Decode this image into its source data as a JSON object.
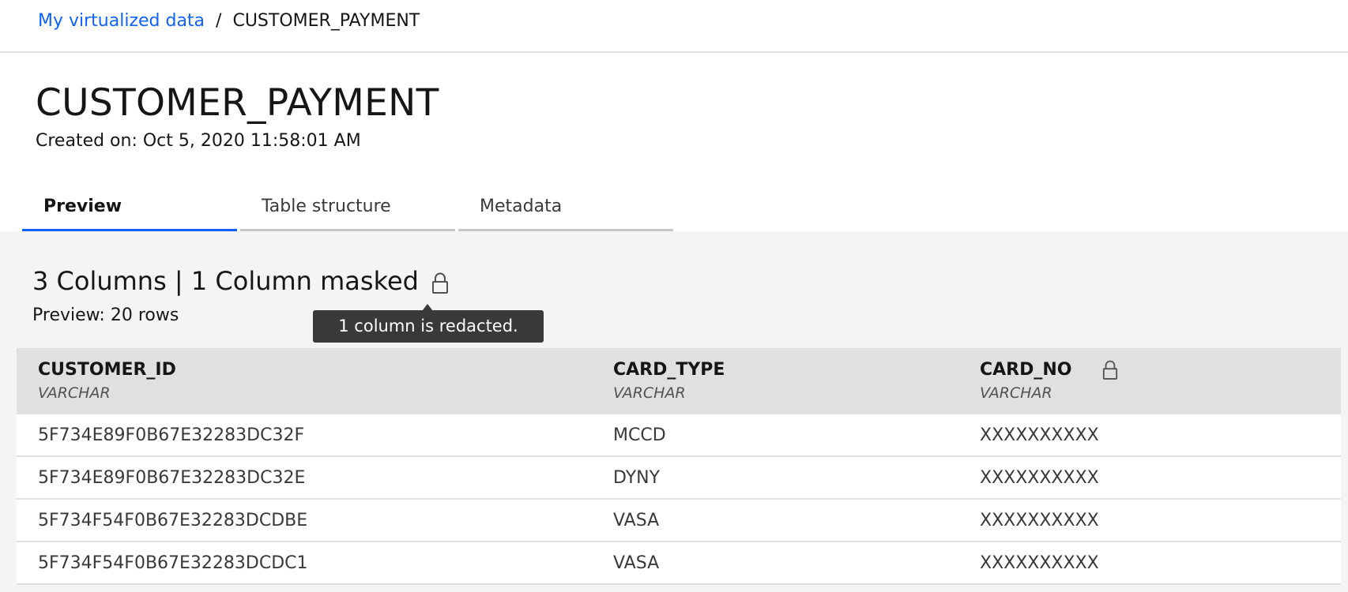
{
  "breadcrumb": {
    "link_label": "My virtualized data",
    "separator": "/",
    "current": "CUSTOMER_PAYMENT"
  },
  "page": {
    "title": "CUSTOMER_PAYMENT",
    "created": "Created on: Oct 5, 2020 11:58:01 AM"
  },
  "tabs": [
    {
      "label": "Preview",
      "active": true
    },
    {
      "label": "Table structure",
      "active": false
    },
    {
      "label": "Metadata",
      "active": false
    }
  ],
  "summary": {
    "text": "3 Columns | 1 Column masked",
    "preview_rows": "Preview: 20 rows",
    "lock_icon": "lock-icon"
  },
  "tooltip": {
    "text": "1 column is redacted."
  },
  "table": {
    "columns": [
      {
        "name": "CUSTOMER_ID",
        "type": "VARCHAR",
        "masked": false
      },
      {
        "name": "CARD_TYPE",
        "type": "VARCHAR",
        "masked": false
      },
      {
        "name": "CARD_NO",
        "type": "VARCHAR",
        "masked": true
      }
    ],
    "rows": [
      [
        "5F734E89F0B67E32283DC32F",
        "MCCD",
        "XXXXXXXXXX"
      ],
      [
        "5F734E89F0B67E32283DC32E",
        "DYNY",
        "XXXXXXXXXX"
      ],
      [
        "5F734F54F0B67E32283DCDBE",
        "VASA",
        "XXXXXXXXXX"
      ],
      [
        "5F734F54F0B67E32283DCDC1",
        "VASA",
        "XXXXXXXXXX"
      ]
    ]
  },
  "colors": {
    "accent": "#0f62fe",
    "header_bg": "#e0e0e0",
    "content_bg": "#f4f4f4",
    "tooltip_bg": "#393939"
  }
}
